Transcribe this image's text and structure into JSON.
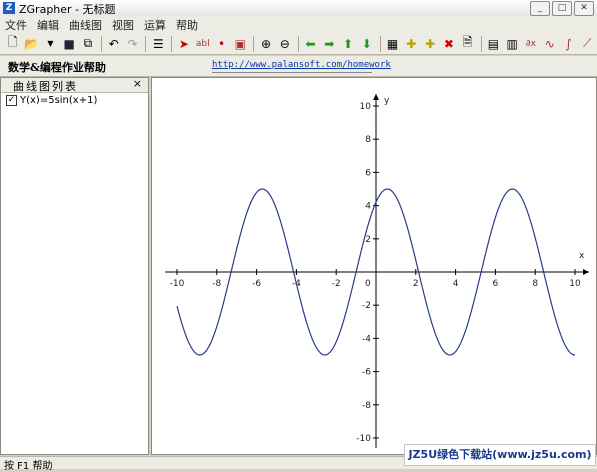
{
  "window": {
    "title": "ZGrapher - 无标题",
    "app_icon_letter": "Z"
  },
  "menu": [
    "文件",
    "编辑",
    "曲线图",
    "视图",
    "运算",
    "帮助"
  ],
  "toolbar_icons": [
    "new-file-icon",
    "open-folder-icon",
    "dropdown-arrow-icon",
    "save-icon",
    "copy-icon",
    "undo-icon",
    "redo-icon",
    "list-icon",
    "pointer-icon",
    "text-icon",
    "point-icon",
    "zoom-window-icon",
    "zoom-in-icon",
    "zoom-out-icon",
    "pan-left-icon",
    "pan-right-icon",
    "pan-up-icon",
    "pan-down-icon",
    "calculator-icon",
    "add-curve-icon",
    "add-point-icon",
    "delete-icon",
    "properties-icon",
    "table-icon",
    "grid-icon",
    "derivative-icon",
    "curve-icon",
    "integral-icon",
    "chart-icon"
  ],
  "adbar": {
    "label": "数学&编程作业帮助",
    "link": "http://www.palansoft.com/homework"
  },
  "left_pane": {
    "title": "曲线图列表",
    "close": "×",
    "curves": [
      {
        "label": "Y(x)=5sin(x+1)",
        "checked": true
      }
    ]
  },
  "status": {
    "text": "按 F1 帮助"
  },
  "watermark": "JZ5U绿色下载站(www.jz5u.com)",
  "chart_data": {
    "type": "line",
    "function": "5sin(x+1)",
    "xlabel": "x",
    "ylabel": "y",
    "xlim": [
      -10,
      10
    ],
    "ylim": [
      -10,
      10
    ],
    "x_ticks": [
      -10,
      -8,
      -6,
      -4,
      -2,
      2,
      4,
      6,
      8,
      10
    ],
    "y_ticks": [
      10,
      8,
      6,
      4,
      2,
      -2,
      -4,
      -6,
      -8,
      -10
    ],
    "origin_label": "0",
    "grid": false,
    "series": [
      {
        "color": "#283c8c"
      }
    ]
  }
}
